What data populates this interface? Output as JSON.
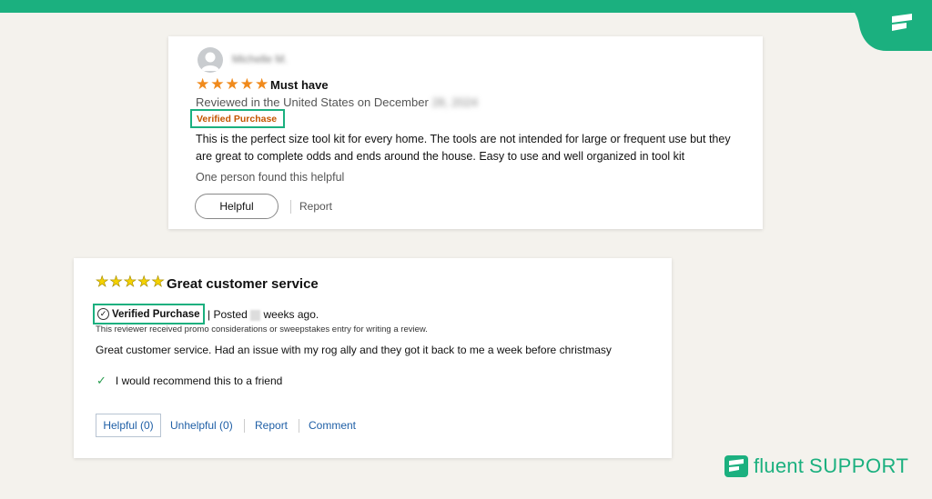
{
  "brand": {
    "accent_color": "#1bb07f",
    "logo_word_1": "fluent",
    "logo_word_2": "SUPPORT"
  },
  "review1": {
    "reviewer_name": "Michelle M.",
    "rating": 5,
    "star_icon": "★",
    "title": "Must have",
    "reviewed_in": "Reviewed in the United States on December",
    "reviewed_date_blurred": "28, 2024",
    "verified_label": "Verified Purchase",
    "body": "This is the perfect size tool kit for every home. The tools are not intended for large or frequent use but they are great to complete odds and ends around the house. Easy to use and well organized in tool kit",
    "helpful_count": "One person found this helpful",
    "helpful_button": "Helpful",
    "report_link": "Report"
  },
  "review2": {
    "rating": 5,
    "star_icon": "★",
    "title": "Great customer service",
    "verified_label": "Verified Purchase",
    "check_icon": "✓",
    "posted_prefix": "| Posted",
    "posted_suffix": "weeks ago.",
    "promo_note": "This reviewer received promo considerations or sweepstakes entry for writing a review.",
    "body": "Great customer service. Had an issue with my rog ally and they got it back to me a week before christmasy",
    "recommend_tick": "✓",
    "recommend_text": "I would recommend this to a friend",
    "helpful_button": "Helpful (0)",
    "unhelpful_link": "Unhelpful (0)",
    "report_link": "Report",
    "comment_link": "Comment"
  }
}
